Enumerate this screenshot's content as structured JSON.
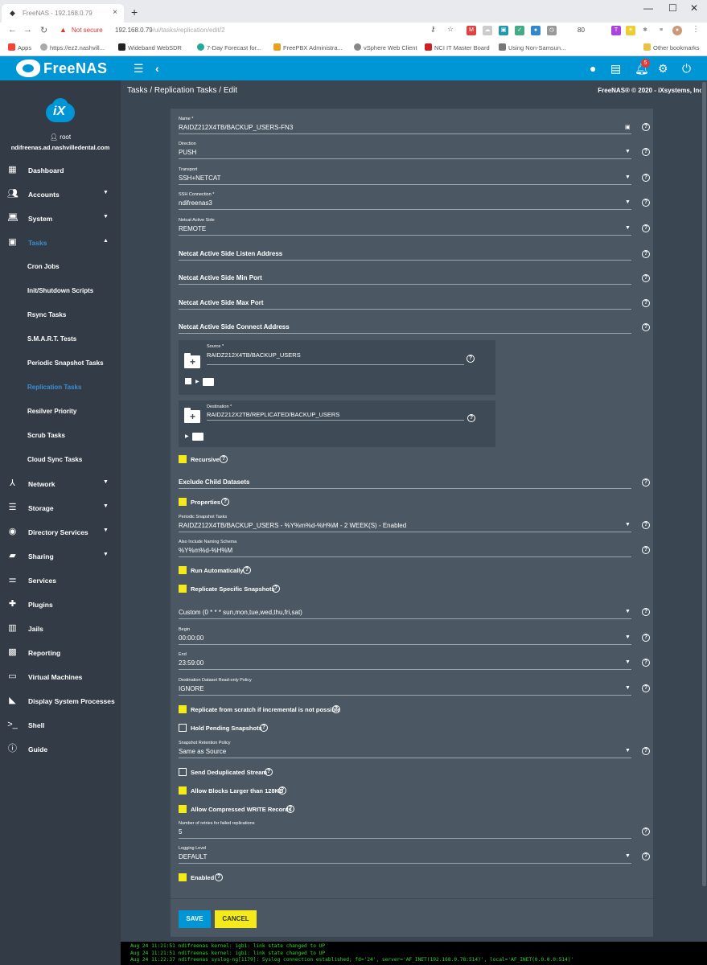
{
  "browser": {
    "tab_title": "FreeNAS - 192.168.0.79",
    "not_secure": "Not secure",
    "url_host": "192.168.0.79",
    "url_path": "/ui/tasks/replication/edit/2",
    "ext_count": "80",
    "bookmarks": [
      "Apps",
      "https://ez2.nashvill...",
      "Wideband WebSDR",
      "7-Day Forecast for...",
      "FreePBX Administra...",
      "vSphere Web Client",
      "NCI IT Master Board",
      "Using Non-Samsun..."
    ],
    "other_bookmarks": "Other bookmarks"
  },
  "header": {
    "logo_text": "FreeNAS",
    "notification_count": "5"
  },
  "sidebar": {
    "user": "root",
    "host": "ndifreenas.ad.nashvilledental.com",
    "items": [
      {
        "label": "Dashboard",
        "icon": "dashboard-icon",
        "arrow": ""
      },
      {
        "label": "Accounts",
        "icon": "accounts-icon",
        "arrow": "▼"
      },
      {
        "label": "System",
        "icon": "system-icon",
        "arrow": "▼"
      },
      {
        "label": "Tasks",
        "icon": "calendar-icon",
        "arrow": "▲"
      },
      {
        "label": "Cron Jobs"
      },
      {
        "label": "Init/Shutdown Scripts"
      },
      {
        "label": "Rsync Tasks"
      },
      {
        "label": "S.M.A.R.T. Tests"
      },
      {
        "label": "Periodic Snapshot Tasks"
      },
      {
        "label": "Replication Tasks"
      },
      {
        "label": "Resilver Priority"
      },
      {
        "label": "Scrub Tasks"
      },
      {
        "label": "Cloud Sync Tasks"
      },
      {
        "label": "Network",
        "icon": "network-icon",
        "arrow": "▼"
      },
      {
        "label": "Storage",
        "icon": "storage-icon",
        "arrow": "▼"
      },
      {
        "label": "Directory Services",
        "icon": "directory-icon",
        "arrow": "▼"
      },
      {
        "label": "Sharing",
        "icon": "sharing-icon",
        "arrow": "▼"
      },
      {
        "label": "Services",
        "icon": "services-icon",
        "arrow": ""
      },
      {
        "label": "Plugins",
        "icon": "plugins-icon",
        "arrow": ""
      },
      {
        "label": "Jails",
        "icon": "jails-icon",
        "arrow": ""
      },
      {
        "label": "Reporting",
        "icon": "reporting-icon",
        "arrow": ""
      },
      {
        "label": "Virtual Machines",
        "icon": "vm-icon",
        "arrow": ""
      },
      {
        "label": "Display System Processes",
        "icon": "processes-icon",
        "arrow": ""
      },
      {
        "label": "Shell",
        "icon": "shell-icon",
        "arrow": ""
      },
      {
        "label": "Guide",
        "icon": "guide-icon",
        "arrow": ""
      }
    ]
  },
  "breadcrumb": {
    "path": "Tasks  /  Replication Tasks  /  Edit",
    "copyright": "FreeNAS® © 2020 - iXsystems, Inc."
  },
  "form": {
    "name": {
      "label": "Name *",
      "value": "RAIDZ212X4TB/BACKUP_USERS-FN3"
    },
    "direction": {
      "label": "Direction",
      "value": "PUSH"
    },
    "transport": {
      "label": "Transport",
      "value": "SSH+NETCAT"
    },
    "ssh_connection": {
      "label": "SSH Connection *",
      "value": "ndifreenas3"
    },
    "netcat_active_side": {
      "label": "Netcat Active Side",
      "value": "REMOTE"
    },
    "netcat_listen_address": {
      "label": "Netcat Active Side Listen Address"
    },
    "netcat_min_port": {
      "label": "Netcat Active Side Min Port"
    },
    "netcat_max_port": {
      "label": "Netcat Active Side Max Port"
    },
    "netcat_connect_address": {
      "label": "Netcat Active Side Connect Address"
    },
    "source": {
      "label": "Source *",
      "value": "RAIDZ212X4TB/BACKUP_USERS"
    },
    "destination": {
      "label": "Destination *",
      "value": "RAIDZ212X2TB/REPLICATED/BACKUP_USERS"
    },
    "recursive": {
      "label": "Recursive",
      "checked": true
    },
    "exclude_child": {
      "label": "Exclude Child Datasets"
    },
    "properties": {
      "label": "Properties",
      "checked": true
    },
    "periodic_snapshot": {
      "label": "Periodic Snapshot Tasks",
      "value": "RAIDZ212X4TB/BACKUP_USERS - %Y%m%d-%H%M - 2 WEEK(S) - Enabled"
    },
    "naming_schema": {
      "label": "Also Include Naming Schema",
      "value": "%Y%m%d-%H%M"
    },
    "run_automatically": {
      "label": "Run Automatically",
      "checked": true
    },
    "replicate_specific": {
      "label": "Replicate Specific Snapshots",
      "checked": true
    },
    "schedule": {
      "value": "Custom (0 * * * sun,mon,tue,wed,thu,fri,sat)"
    },
    "begin": {
      "label": "Begin",
      "value": "00:00:00"
    },
    "end": {
      "label": "End",
      "value": "23:59:00"
    },
    "readonly_policy": {
      "label": "Destination Dataset Read-only Policy",
      "value": "IGNORE"
    },
    "from_scratch": {
      "label": "Replicate from scratch if incremental is not possible",
      "checked": true
    },
    "hold_pending": {
      "label": "Hold Pending Snapshots",
      "checked": false
    },
    "retention_policy": {
      "label": "Snapshot Retention Policy",
      "value": "Same as Source"
    },
    "dedup_stream": {
      "label": "Send Deduplicated Stream",
      "checked": false
    },
    "large_blocks": {
      "label": "Allow Blocks Larger than 128KB",
      "checked": true
    },
    "compressed_write": {
      "label": "Allow Compressed WRITE Records",
      "checked": true
    },
    "retries": {
      "label": "Number of retries for failed replications",
      "value": "5"
    },
    "logging_level": {
      "label": "Logging Level",
      "value": "DEFAULT"
    },
    "enabled": {
      "label": "Enabled",
      "checked": true
    },
    "save_label": "SAVE",
    "cancel_label": "CANCEL"
  },
  "console": [
    "Aug 24 11:21:51 ndifreenas kernel: igb1: link state changed to UP",
    "Aug 24 11:21:51 ndifreenas kernel: igb1: link state changed to UP",
    "Aug 24 11:22:37 ndifreenas syslog-ng[1179]: Syslog connection established; fd='24', server='AF_INET(192.168.0.78:514)', local='AF_INET(0.0.0.0:514)'"
  ],
  "colors": {
    "accent": "#0095d5",
    "checkbox": "#f4ea1a",
    "sidebar": "#333c46",
    "card": "#4b5864",
    "active_nav": "#3b8ed0"
  }
}
